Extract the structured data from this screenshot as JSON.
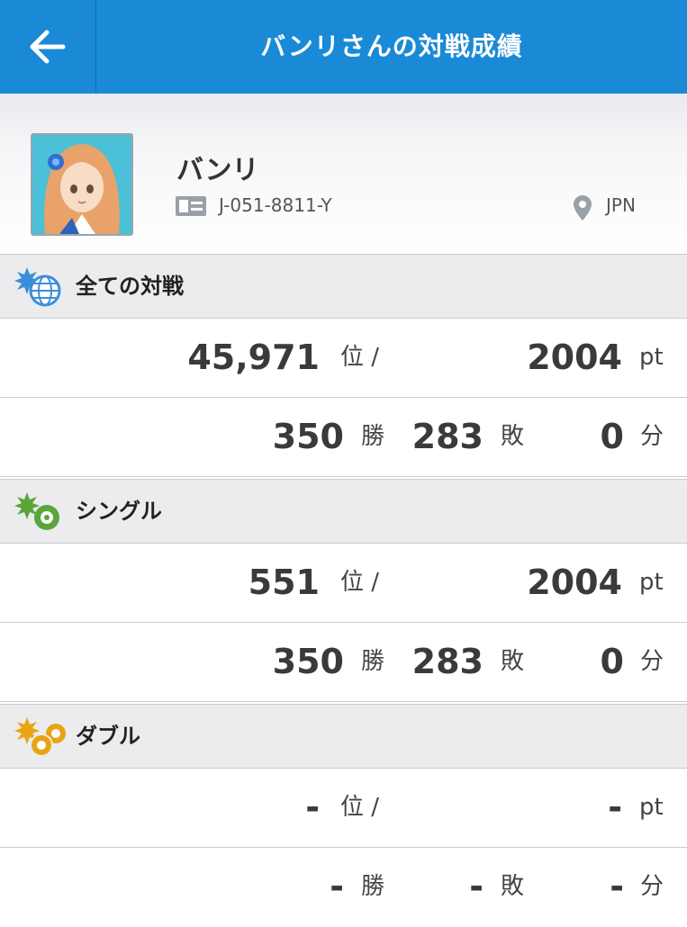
{
  "header": {
    "title": "バンリさんの対戦成績",
    "back_icon": "arrow-left-icon"
  },
  "profile": {
    "name": "バンリ",
    "id_icon": "id-card-icon",
    "player_id": "J-051-8811-Y",
    "location_icon": "location-pin-icon",
    "country": "JPN"
  },
  "sections": [
    {
      "title": "全ての対戦",
      "icon": "globe-icon",
      "rank": "45,971",
      "rank_unit": "位 /",
      "points": "2004",
      "points_unit": "pt",
      "wins": "350",
      "wins_unit": "勝",
      "losses": "283",
      "losses_unit": "敗",
      "draws": "0",
      "draws_unit": "分"
    },
    {
      "title": "シングル",
      "icon": "single-battle-icon",
      "rank": "551",
      "rank_unit": "位 /",
      "points": "2004",
      "points_unit": "pt",
      "wins": "350",
      "wins_unit": "勝",
      "losses": "283",
      "losses_unit": "敗",
      "draws": "0",
      "draws_unit": "分"
    },
    {
      "title": "ダブル",
      "icon": "double-battle-icon",
      "rank": "-",
      "rank_unit": "位 /",
      "points": "-",
      "points_unit": "pt",
      "wins": "-",
      "wins_unit": "勝",
      "losses": "-",
      "losses_unit": "敗",
      "draws": "-",
      "draws_unit": "分"
    }
  ],
  "colors": {
    "header": "#1a8ad6",
    "section_bg": "#ececef",
    "globe_icon": "#3b8fd9",
    "single_icon": "#5aa63a",
    "double_icon": "#e8a412"
  }
}
